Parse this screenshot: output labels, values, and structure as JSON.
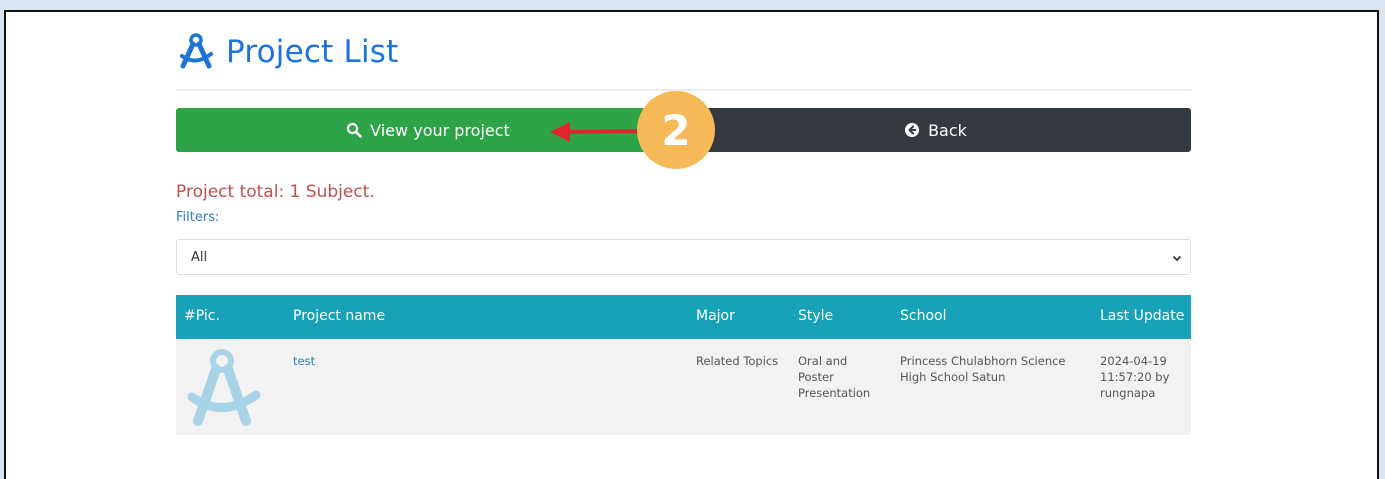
{
  "header": {
    "title": "Project List",
    "icon": "compass-icon"
  },
  "buttons": {
    "view_label": "View your project",
    "view_icon": "search-icon",
    "back_label": "Back",
    "back_icon": "circle-arrow-left-icon"
  },
  "annotation": {
    "step_number": "2",
    "arrow_color": "#e0262b",
    "badge_color": "#f6b957"
  },
  "summary": {
    "total_text": "Project total: 1 Subject."
  },
  "filters": {
    "label": "Filters:",
    "selected": "All"
  },
  "table": {
    "columns": [
      "#Pic.",
      "Project name",
      "Major",
      "Style",
      "School",
      "Last Update"
    ],
    "rows": [
      {
        "pic_icon": "compass-icon",
        "project_name": "test",
        "major": "Related Topics",
        "style": [
          "Oral and",
          "Poster",
          "Presentation"
        ],
        "school": [
          "Princess Chulabhorn Science",
          "High School Satun"
        ],
        "last_update": [
          "2024-04-19",
          "11:57:20 by",
          "rungnapa"
        ]
      }
    ]
  },
  "colors": {
    "accent_blue": "#1d74d8",
    "view_button": "#2fa348",
    "back_button": "#343a40",
    "table_header": "#17a2b8",
    "total_text": "#c0504d"
  }
}
